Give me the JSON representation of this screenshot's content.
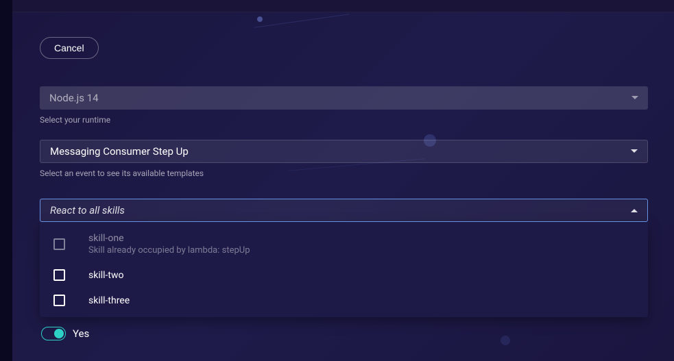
{
  "header": {
    "cancel_label": "Cancel"
  },
  "runtime": {
    "selected": "Node.js 14",
    "helper": "Select your runtime"
  },
  "event": {
    "selected": "Messaging Consumer Step Up",
    "helper": "Select an event to see its available templates"
  },
  "skills": {
    "placeholder": "React to all skills",
    "options": [
      {
        "label": "skill-one",
        "sublabel": "Skill already occupied by lambda: stepUp",
        "disabled": true,
        "checked": false
      },
      {
        "label": "skill-two",
        "disabled": false,
        "checked": false
      },
      {
        "label": "skill-three",
        "disabled": false,
        "checked": false
      }
    ]
  },
  "toggle": {
    "value": true,
    "label": "Yes"
  }
}
